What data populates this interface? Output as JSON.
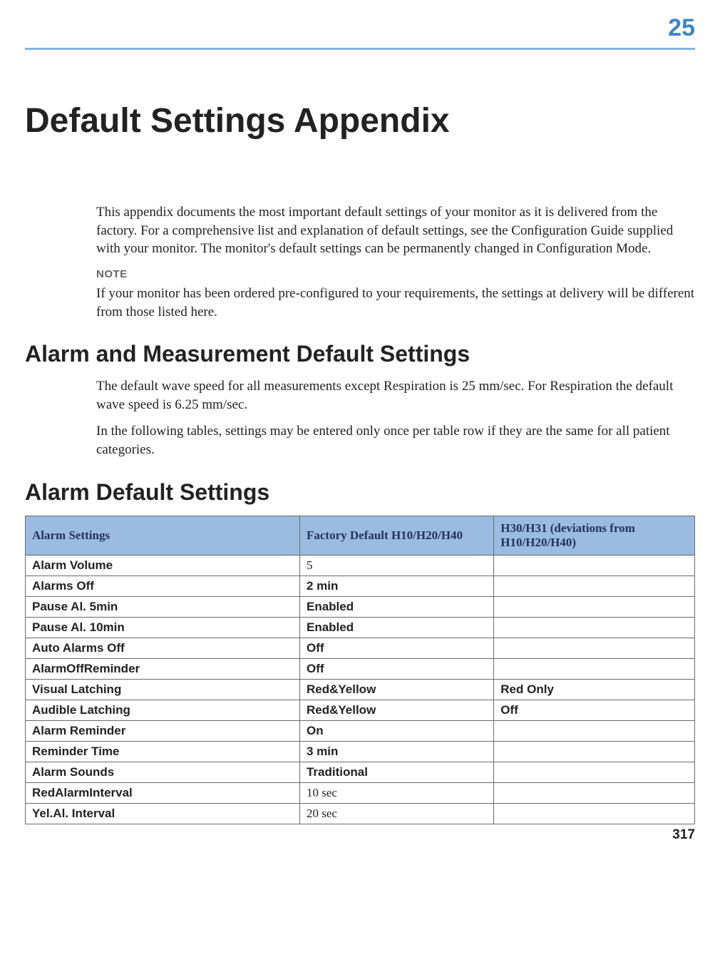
{
  "chapter_number": "25",
  "title": "Default Settings Appendix",
  "intro_paragraph": "This appendix documents the most important default settings of your monitor as it is delivered from the factory. For a comprehensive list and explanation of default settings, see the Configuration Guide supplied with your monitor. The monitor's default settings can be permanently changed in Configuration Mode.",
  "note_label": "NOTE",
  "note_text": "If your monitor has been ordered pre-configured to your requirements, the settings at delivery will be different from those listed here.",
  "section1_heading": "Alarm and Measurement Default Settings",
  "section1_para1": "The default wave speed for all measurements except Respiration is 25 mm/sec. For Respiration the default wave speed is 6.25 mm/sec.",
  "section1_para2": "In the following tables, settings may be entered only once per table row if they are the same for all patient categories.",
  "section2_heading": "Alarm Default Settings",
  "table": {
    "headers": {
      "col1": "Alarm Settings",
      "col2": "Factory Default H10/H20/H40",
      "col3": "H30/H31 (deviations from H10/H20/H40)"
    },
    "rows": [
      {
        "name": "Alarm Volume",
        "val": "5",
        "dev": "",
        "val_style": "serif"
      },
      {
        "name": "Alarms Off",
        "val": "2 min",
        "dev": "",
        "val_style": "bold"
      },
      {
        "name": "Pause Al. 5min",
        "val": "Enabled",
        "dev": "",
        "val_style": "bold"
      },
      {
        "name": "Pause Al. 10min",
        "val": "Enabled",
        "dev": "",
        "val_style": "bold"
      },
      {
        "name": "Auto Alarms Off",
        "val": "Off",
        "dev": "",
        "val_style": "bold"
      },
      {
        "name": "AlarmOffReminder",
        "val": "Off",
        "dev": "",
        "val_style": "bold"
      },
      {
        "name": "Visual Latching",
        "val": "Red&Yellow",
        "dev": "Red Only",
        "val_style": "bold"
      },
      {
        "name": "Audible Latching",
        "val": "Red&Yellow",
        "dev": "Off",
        "val_style": "bold"
      },
      {
        "name": "Alarm Reminder",
        "val": "On",
        "dev": "",
        "val_style": "bold"
      },
      {
        "name": "Reminder Time",
        "val": "3 min",
        "dev": "",
        "val_style": "bold"
      },
      {
        "name": "Alarm Sounds",
        "val": "Traditional",
        "dev": "",
        "val_style": "bold"
      },
      {
        "name": "RedAlarmInterval",
        "val": "10 sec",
        "dev": "",
        "val_style": "serif"
      },
      {
        "name": "Yel.Al. Interval",
        "val": "20 sec",
        "dev": "",
        "val_style": "serif"
      }
    ]
  },
  "page_number": "317"
}
